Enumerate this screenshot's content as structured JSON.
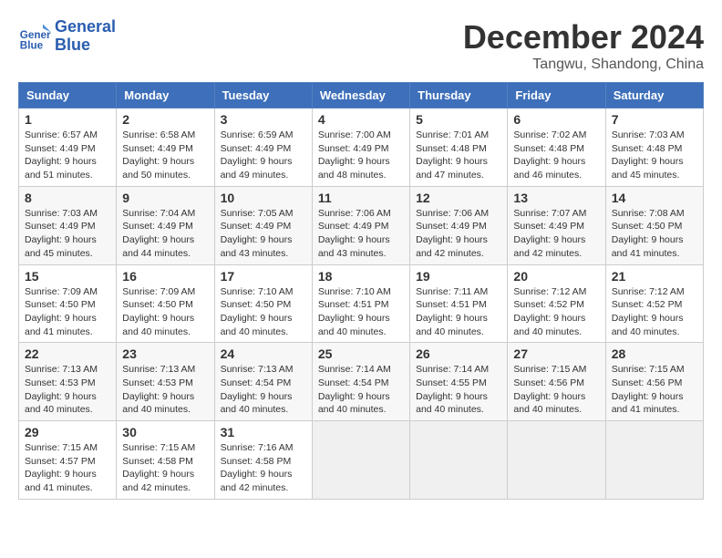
{
  "header": {
    "logo_line1": "General",
    "logo_line2": "Blue",
    "month": "December 2024",
    "location": "Tangwu, Shandong, China"
  },
  "days_of_week": [
    "Sunday",
    "Monday",
    "Tuesday",
    "Wednesday",
    "Thursday",
    "Friday",
    "Saturday"
  ],
  "weeks": [
    [
      {
        "day": "1",
        "sunrise": "6:57 AM",
        "sunset": "4:49 PM",
        "daylight": "9 hours and 51 minutes."
      },
      {
        "day": "2",
        "sunrise": "6:58 AM",
        "sunset": "4:49 PM",
        "daylight": "9 hours and 50 minutes."
      },
      {
        "day": "3",
        "sunrise": "6:59 AM",
        "sunset": "4:49 PM",
        "daylight": "9 hours and 49 minutes."
      },
      {
        "day": "4",
        "sunrise": "7:00 AM",
        "sunset": "4:49 PM",
        "daylight": "9 hours and 48 minutes."
      },
      {
        "day": "5",
        "sunrise": "7:01 AM",
        "sunset": "4:48 PM",
        "daylight": "9 hours and 47 minutes."
      },
      {
        "day": "6",
        "sunrise": "7:02 AM",
        "sunset": "4:48 PM",
        "daylight": "9 hours and 46 minutes."
      },
      {
        "day": "7",
        "sunrise": "7:03 AM",
        "sunset": "4:48 PM",
        "daylight": "9 hours and 45 minutes."
      }
    ],
    [
      {
        "day": "8",
        "sunrise": "7:03 AM",
        "sunset": "4:49 PM",
        "daylight": "9 hours and 45 minutes."
      },
      {
        "day": "9",
        "sunrise": "7:04 AM",
        "sunset": "4:49 PM",
        "daylight": "9 hours and 44 minutes."
      },
      {
        "day": "10",
        "sunrise": "7:05 AM",
        "sunset": "4:49 PM",
        "daylight": "9 hours and 43 minutes."
      },
      {
        "day": "11",
        "sunrise": "7:06 AM",
        "sunset": "4:49 PM",
        "daylight": "9 hours and 43 minutes."
      },
      {
        "day": "12",
        "sunrise": "7:06 AM",
        "sunset": "4:49 PM",
        "daylight": "9 hours and 42 minutes."
      },
      {
        "day": "13",
        "sunrise": "7:07 AM",
        "sunset": "4:49 PM",
        "daylight": "9 hours and 42 minutes."
      },
      {
        "day": "14",
        "sunrise": "7:08 AM",
        "sunset": "4:50 PM",
        "daylight": "9 hours and 41 minutes."
      }
    ],
    [
      {
        "day": "15",
        "sunrise": "7:09 AM",
        "sunset": "4:50 PM",
        "daylight": "9 hours and 41 minutes."
      },
      {
        "day": "16",
        "sunrise": "7:09 AM",
        "sunset": "4:50 PM",
        "daylight": "9 hours and 40 minutes."
      },
      {
        "day": "17",
        "sunrise": "7:10 AM",
        "sunset": "4:50 PM",
        "daylight": "9 hours and 40 minutes."
      },
      {
        "day": "18",
        "sunrise": "7:10 AM",
        "sunset": "4:51 PM",
        "daylight": "9 hours and 40 minutes."
      },
      {
        "day": "19",
        "sunrise": "7:11 AM",
        "sunset": "4:51 PM",
        "daylight": "9 hours and 40 minutes."
      },
      {
        "day": "20",
        "sunrise": "7:12 AM",
        "sunset": "4:52 PM",
        "daylight": "9 hours and 40 minutes."
      },
      {
        "day": "21",
        "sunrise": "7:12 AM",
        "sunset": "4:52 PM",
        "daylight": "9 hours and 40 minutes."
      }
    ],
    [
      {
        "day": "22",
        "sunrise": "7:13 AM",
        "sunset": "4:53 PM",
        "daylight": "9 hours and 40 minutes."
      },
      {
        "day": "23",
        "sunrise": "7:13 AM",
        "sunset": "4:53 PM",
        "daylight": "9 hours and 40 minutes."
      },
      {
        "day": "24",
        "sunrise": "7:13 AM",
        "sunset": "4:54 PM",
        "daylight": "9 hours and 40 minutes."
      },
      {
        "day": "25",
        "sunrise": "7:14 AM",
        "sunset": "4:54 PM",
        "daylight": "9 hours and 40 minutes."
      },
      {
        "day": "26",
        "sunrise": "7:14 AM",
        "sunset": "4:55 PM",
        "daylight": "9 hours and 40 minutes."
      },
      {
        "day": "27",
        "sunrise": "7:15 AM",
        "sunset": "4:56 PM",
        "daylight": "9 hours and 40 minutes."
      },
      {
        "day": "28",
        "sunrise": "7:15 AM",
        "sunset": "4:56 PM",
        "daylight": "9 hours and 41 minutes."
      }
    ],
    [
      {
        "day": "29",
        "sunrise": "7:15 AM",
        "sunset": "4:57 PM",
        "daylight": "9 hours and 41 minutes."
      },
      {
        "day": "30",
        "sunrise": "7:15 AM",
        "sunset": "4:58 PM",
        "daylight": "9 hours and 42 minutes."
      },
      {
        "day": "31",
        "sunrise": "7:16 AM",
        "sunset": "4:58 PM",
        "daylight": "9 hours and 42 minutes."
      },
      null,
      null,
      null,
      null
    ]
  ]
}
